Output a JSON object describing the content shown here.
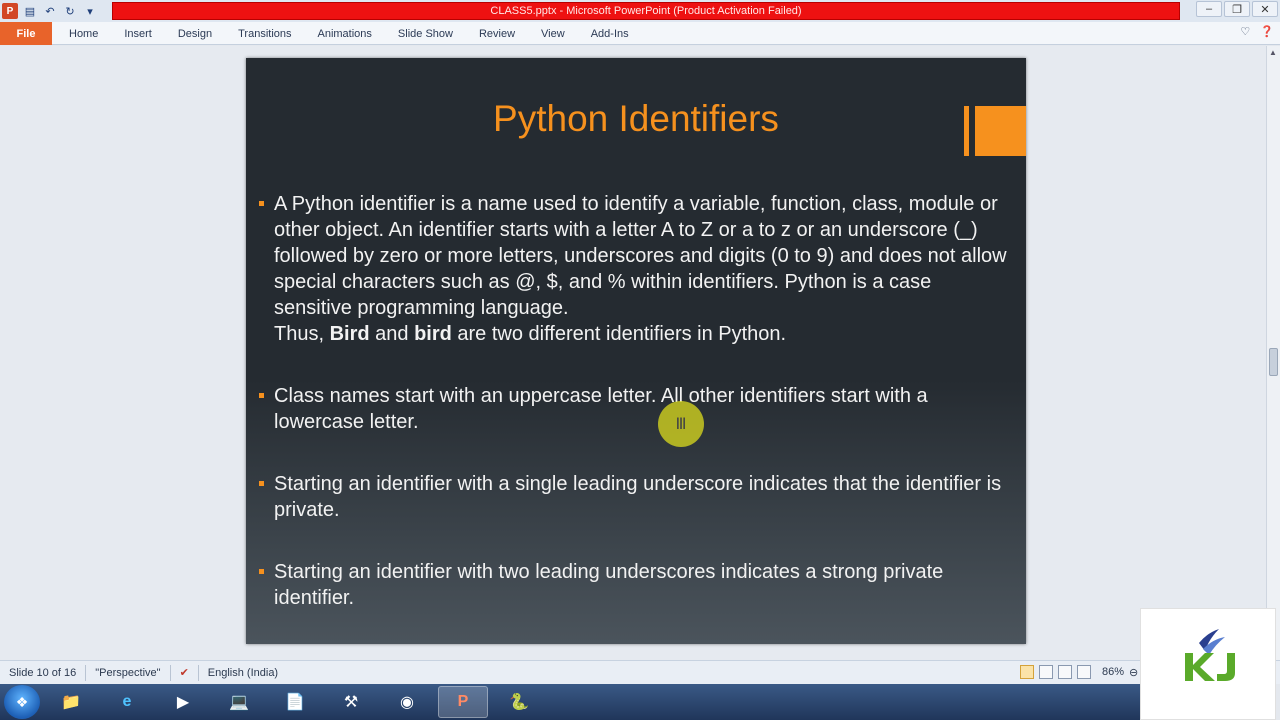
{
  "window": {
    "title": "CLASS5.pptx - Microsoft PowerPoint (Product Activation Failed)"
  },
  "ribbon": {
    "file_label": "File",
    "tabs": [
      "Home",
      "Insert",
      "Design",
      "Transitions",
      "Animations",
      "Slide Show",
      "Review",
      "View",
      "Add-Ins"
    ]
  },
  "slide": {
    "title": "Python Identifiers",
    "bullets": [
      {
        "text": "A Python identifier is a name used to identify a variable, function, class, module or other object. An identifier starts with a letter A to Z or a to z or an underscore (_) followed by zero or more letters, underscores and digits (0 to 9) and does not allow special characters such as @, $, and % within identifiers. Python is a case sensitive programming language.",
        "line2_prefix": "Thus, ",
        "line2_bold1": "Bird",
        "line2_mid": " and ",
        "line2_bold2": "bird",
        "line2_suffix": " are two different identifiers in Python."
      },
      {
        "text": "Class names start with an uppercase letter. All other identifiers start with a lowercase letter."
      },
      {
        "text": "Starting an identifier with a single leading underscore indicates that the identifier is private."
      },
      {
        "text": "Starting an identifier with two leading underscores indicates a strong private identifier."
      }
    ]
  },
  "statusbar": {
    "slide_info": "Slide 10 of 16",
    "theme": "\"Perspective\"",
    "language": "English (India)",
    "zoom": "86%"
  },
  "colors": {
    "accent": "#f6911e",
    "title_bar_red": "#ee1111",
    "file_tab": "#e8632a"
  }
}
